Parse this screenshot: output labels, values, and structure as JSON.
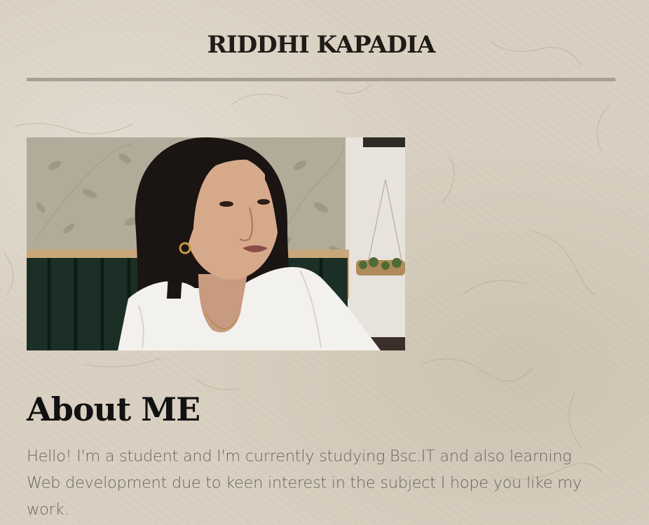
{
  "header": {
    "title": "RIDDHI KAPADIA"
  },
  "profile": {
    "photo_icon": "portrait-photo",
    "photo_alt": "Portrait photo"
  },
  "about": {
    "heading": "About ME",
    "text": "Hello! I'm a student and I'm currently studying Bsc.IT and also learning Web development due to keen interest in the subject I hope you like my work."
  },
  "colors": {
    "background": "#d9d0c1",
    "title": "#1f1b17",
    "rule": "#a79f93",
    "body_text": "#6a6560"
  }
}
